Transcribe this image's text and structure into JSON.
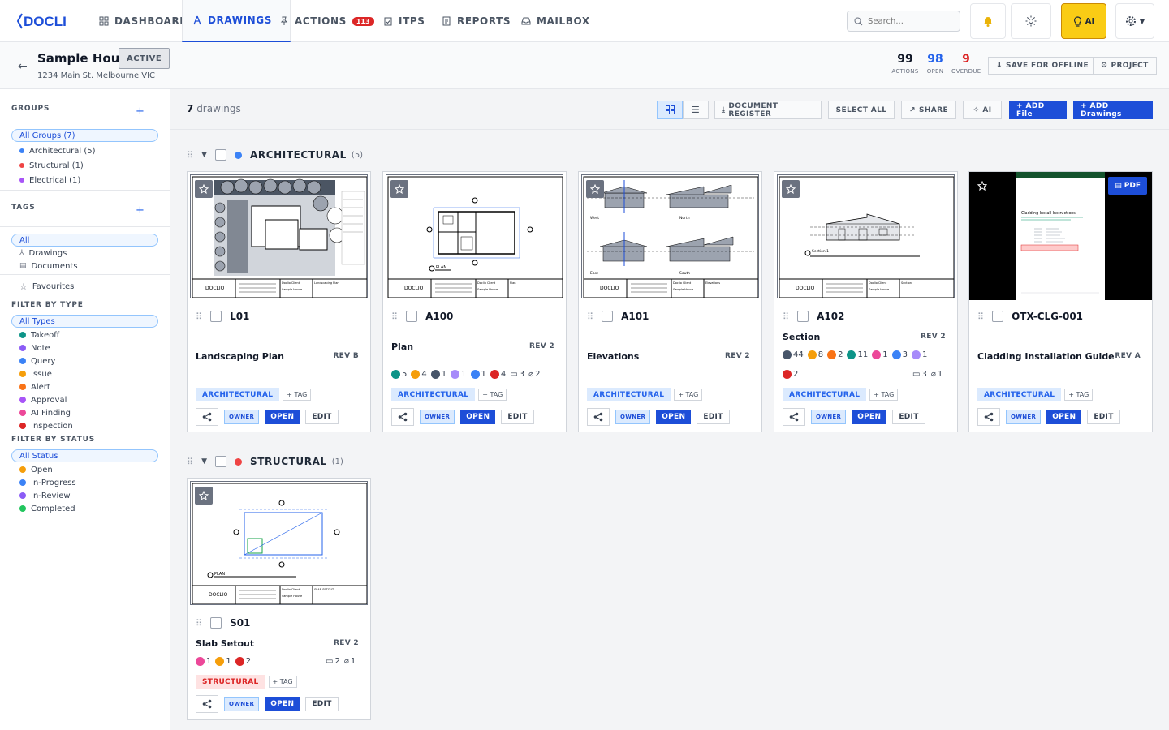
{
  "app": {
    "logo": "DOCLIO"
  },
  "nav": {
    "dashboard": "DASHBOARD",
    "drawings": "DRAWINGS",
    "actions": "ACTIONS",
    "actions_badge": "113",
    "itps": "ITPS",
    "reports": "REPORTS",
    "mailbox": "MAILBOX",
    "search_placeholder": "Search...",
    "ai_label": "AI"
  },
  "project": {
    "name": "Sample House",
    "status": "ACTIVE",
    "address": "1234 Main St. Melbourne VIC",
    "stats": [
      {
        "value": "99",
        "label": "ACTIONS",
        "color": "#111827"
      },
      {
        "value": "98",
        "label": "OPEN",
        "color": "#2563eb"
      },
      {
        "value": "9",
        "label": "OVERDUE",
        "color": "#dc2626"
      }
    ],
    "save_offline": "SAVE FOR OFFLINE",
    "project_btn": "PROJECT"
  },
  "sidebar": {
    "groups_title": "GROUPS",
    "all_groups": "All Groups (7)",
    "groups": [
      {
        "label": "Architectural (5)",
        "color": "#3b82f6"
      },
      {
        "label": "Structural (1)",
        "color": "#ef4444"
      },
      {
        "label": "Electrical (1)",
        "color": "#a855f7"
      }
    ],
    "tags_title": "TAGS",
    "all_tags": "All",
    "drawings_label": "Drawings",
    "documents_label": "Documents",
    "favourites_label": "Favourites",
    "filter_type_title": "FILTER BY TYPE",
    "all_types": "All Types",
    "types": [
      {
        "label": "Takeoff",
        "color": "#0d9488"
      },
      {
        "label": "Note",
        "color": "#8b5cf6"
      },
      {
        "label": "Query",
        "color": "#3b82f6"
      },
      {
        "label": "Issue",
        "color": "#f59e0b"
      },
      {
        "label": "Alert",
        "color": "#f97316"
      },
      {
        "label": "Approval",
        "color": "#a855f7"
      },
      {
        "label": "AI Finding",
        "color": "#ec4899"
      },
      {
        "label": "Inspection",
        "color": "#dc2626"
      }
    ],
    "filter_status_title": "FILTER BY STATUS",
    "all_status": "All Status",
    "statuses": [
      {
        "label": "Open",
        "color": "#f59e0b"
      },
      {
        "label": "In-Progress",
        "color": "#3b82f6"
      },
      {
        "label": "In-Review",
        "color": "#8b5cf6"
      },
      {
        "label": "Completed",
        "color": "#22c55e"
      }
    ]
  },
  "toolbar": {
    "count": "7",
    "count_label": "drawings",
    "doc_register": "DOCUMENT REGISTER",
    "select_all": "SELECT ALL",
    "share": "SHARE",
    "ai": "AI",
    "add_file": "+ ADD File",
    "add_drawings": "+ ADD Drawings"
  },
  "groups": [
    {
      "name": "ARCHITECTURAL",
      "count": "(5)",
      "color": "#3b82f6"
    },
    {
      "name": "STRUCTURAL",
      "count": "(1)",
      "color": "#ef4444"
    }
  ],
  "labels": {
    "add_tag": "+ TAG",
    "owner": "OWNER",
    "open": "OPEN",
    "edit": "EDIT",
    "pdf": "PDF"
  },
  "cards": [
    {
      "code": "L01",
      "title": "Landscaping Plan",
      "rev": "REV B",
      "tag": "ARCHITECTURAL",
      "chips": [],
      "stats": []
    },
    {
      "code": "A100",
      "title": "Plan",
      "rev": "REV 2",
      "tag": "ARCHITECTURAL",
      "chips": [
        {
          "v": "5",
          "c": "#0d9488",
          "t": "teal"
        },
        {
          "v": "4",
          "c": "#f59e0b",
          "t": "amber"
        },
        {
          "v": "1",
          "c": "#475569",
          "t": "slate"
        },
        {
          "v": "1",
          "c": "#a78bfa",
          "t": "violet"
        },
        {
          "v": "1",
          "c": "#3b82f6",
          "t": "blue"
        },
        {
          "v": "4",
          "c": "#dc2626",
          "t": "red"
        }
      ],
      "stats": [
        {
          "v": "3",
          "t": "comment"
        },
        {
          "v": "2",
          "t": "clip"
        }
      ]
    },
    {
      "code": "A101",
      "title": "Elevations",
      "rev": "REV 2",
      "tag": "ARCHITECTURAL",
      "chips": [],
      "stats": []
    },
    {
      "code": "A102",
      "title": "Section",
      "rev": "REV 2",
      "tag": "ARCHITECTURAL",
      "chips": [
        {
          "v": "44",
          "c": "#475569"
        },
        {
          "v": "8",
          "c": "#f59e0b"
        },
        {
          "v": "2",
          "c": "#f97316"
        },
        {
          "v": "11",
          "c": "#0d9488"
        },
        {
          "v": "1",
          "c": "#ec4899"
        },
        {
          "v": "3",
          "c": "#3b82f6"
        },
        {
          "v": "1",
          "c": "#a78bfa"
        }
      ],
      "chips2": [
        {
          "v": "2",
          "c": "#dc2626"
        }
      ],
      "stats": [
        {
          "v": "3",
          "t": "comment"
        },
        {
          "v": "1",
          "t": "clip"
        }
      ]
    },
    {
      "code": "OTX-CLG-001",
      "title": "Cladding Installation Guide",
      "rev": "REV A",
      "tag": "ARCHITECTURAL",
      "chips": [],
      "stats": []
    },
    {
      "code": "S01",
      "title": "Slab Setout",
      "rev": "REV 2",
      "tag": "STRUCTURAL",
      "chips": [
        {
          "v": "1",
          "c": "#ec4899"
        },
        {
          "v": "1",
          "c": "#f59e0b"
        },
        {
          "v": "2",
          "c": "#dc2626"
        }
      ],
      "stats": [
        {
          "v": "2",
          "t": "comment"
        },
        {
          "v": "1",
          "t": "clip"
        }
      ]
    }
  ],
  "thumb_text": {
    "titleblock_logo": "DOCLIO",
    "client": "Doclio Client",
    "project": "Sample House",
    "l01_name": "Landscaping Plan",
    "a100_name": "Plan",
    "a101_name": "Elevations",
    "a102_name": "Section",
    "s01_name": "SLAB SETOUT",
    "plan_label": "PLAN",
    "west": "West",
    "north": "North",
    "east": "East",
    "south": "South",
    "section_label": "Section 1",
    "pdf_heading": "Cladding Install Instructions"
  }
}
